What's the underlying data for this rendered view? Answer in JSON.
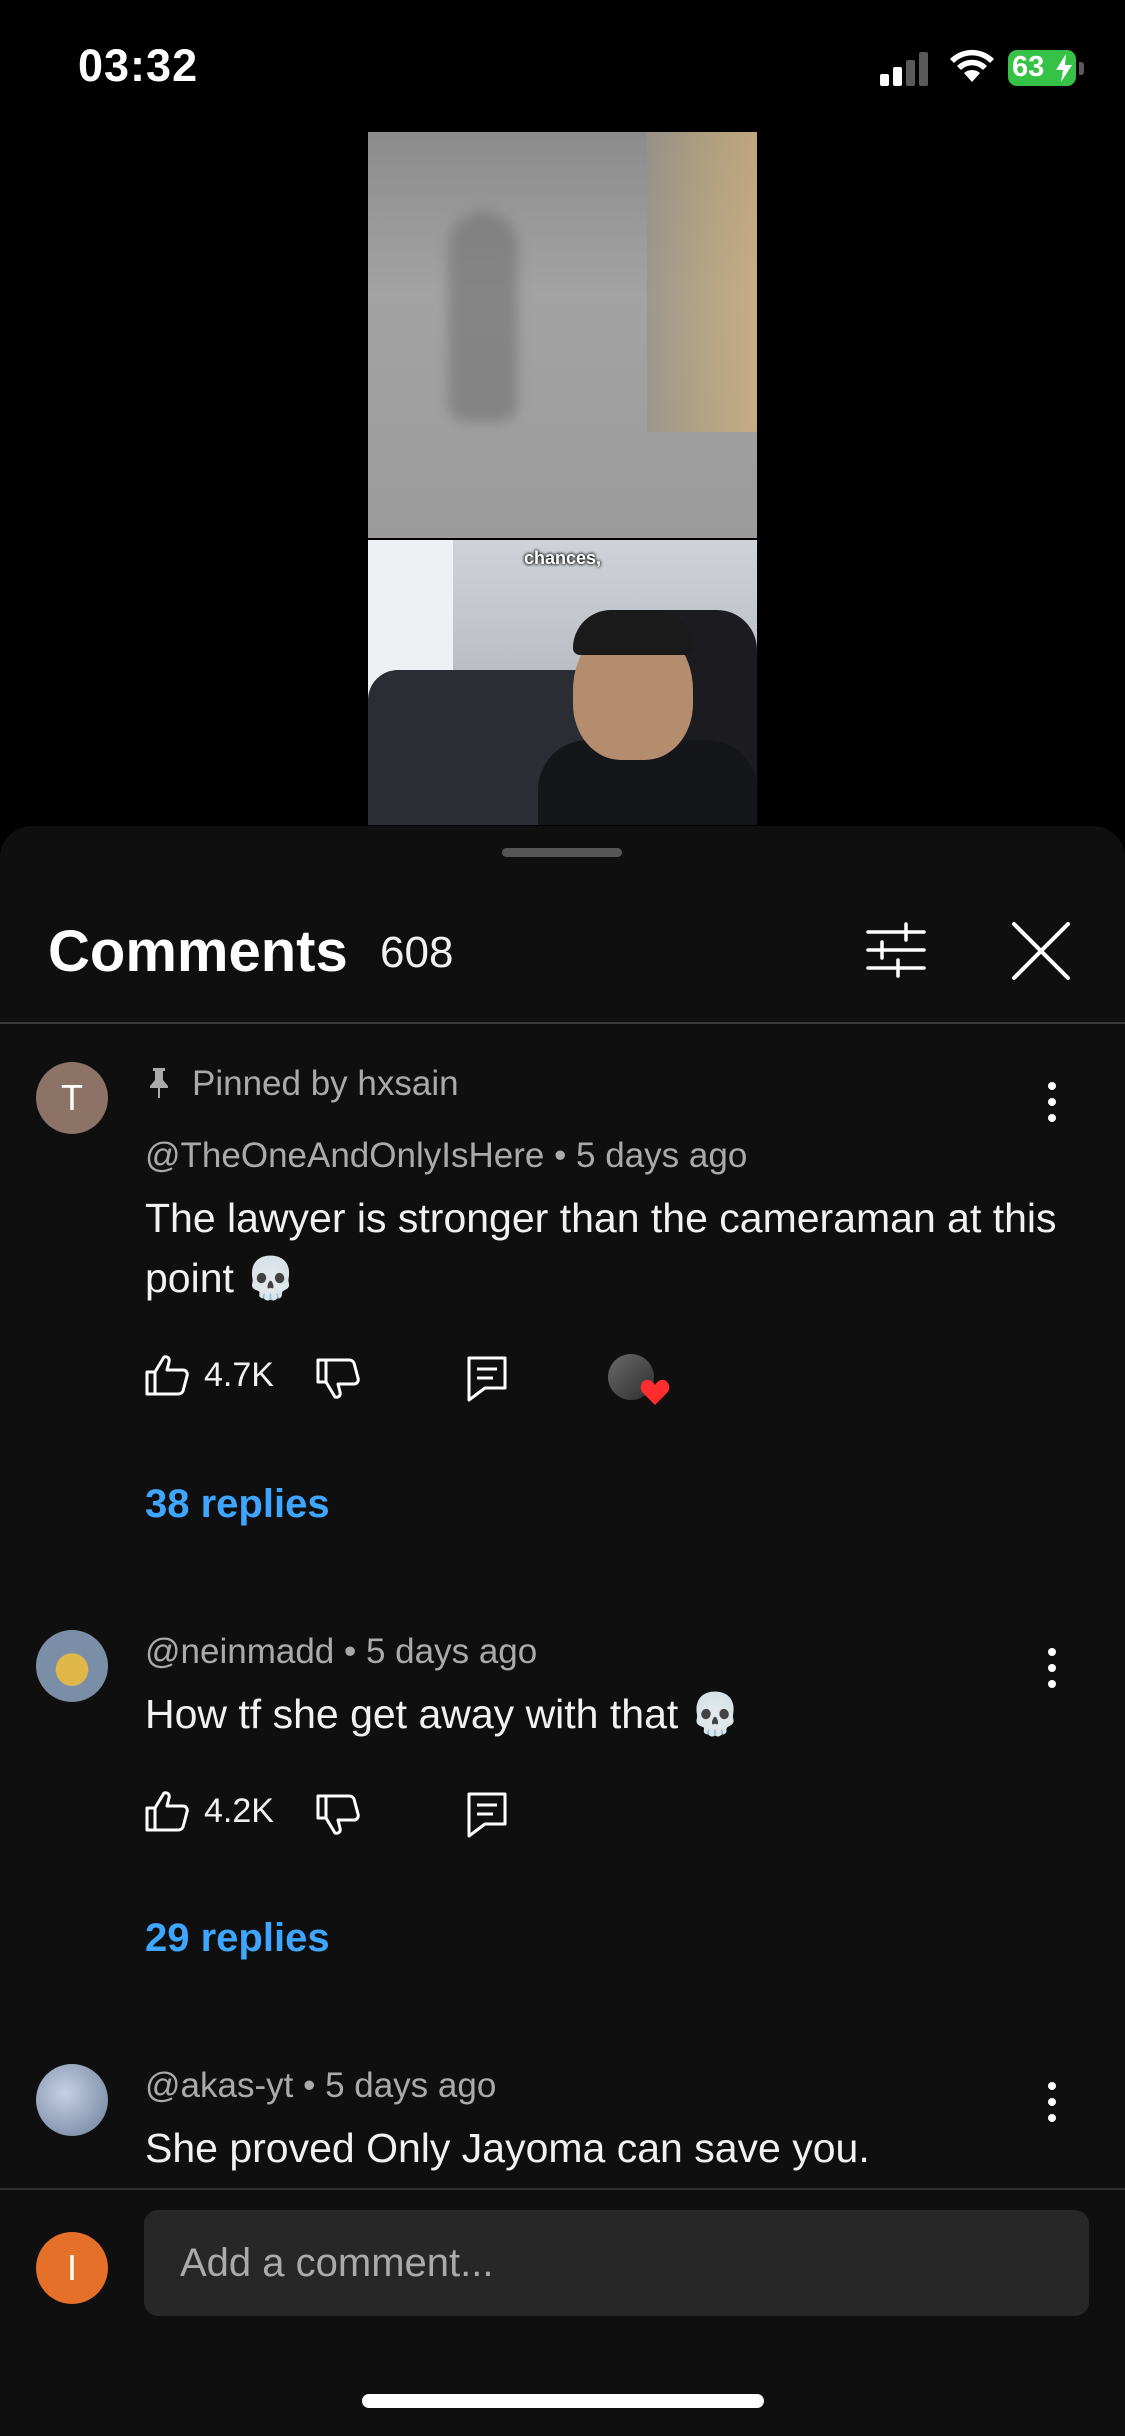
{
  "status_bar": {
    "time": "03:32",
    "battery": "63"
  },
  "video": {
    "caption": "chances,"
  },
  "comments_sheet": {
    "title": "Comments",
    "count": "608",
    "comments": [
      {
        "avatar_letter": "T",
        "pinned_label": "Pinned by hxsain",
        "author": "@TheOneAndOnlyIsHere",
        "time": "5 days ago",
        "text": "The lawyer is stronger than the cameraman at this point 💀",
        "likes": "4.7K",
        "replies": "38 replies"
      },
      {
        "author": "@neinmadd",
        "time": "5 days ago",
        "text": "How tf she get away with that 💀",
        "likes": "4.2K",
        "replies": "29 replies"
      },
      {
        "author": "@akas-yt",
        "time": "5 days ago",
        "text": "She proved Only Jayoma can save you."
      }
    ]
  },
  "composer": {
    "avatar_letter": "I",
    "placeholder": "Add a comment..."
  },
  "colors": {
    "link": "#3ea6ff",
    "heart": "#ff2d2d",
    "sheet_bg": "#0f0f0f",
    "user_avatar": "#e57029"
  }
}
